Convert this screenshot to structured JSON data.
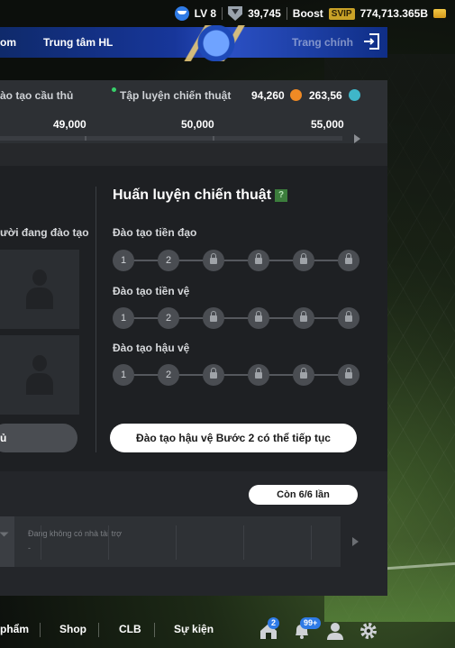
{
  "resources": {
    "level": "LV 8",
    "shield_value": "39,745",
    "boost_label": "Boost",
    "svip_label": "SVIP",
    "coins": "774,713.365B"
  },
  "nav": {
    "tab_left_partial": "om",
    "tab_center": "Trung tâm HL",
    "tab_right": "Trang chính"
  },
  "header": {
    "left_partial": "ào tạo cầu thủ",
    "right_label": "Tập luyện chiến thuật",
    "value_a": "94,260",
    "value_b": "263,56"
  },
  "progress": {
    "milestones": [
      "49,000",
      "50,000",
      "55,000"
    ]
  },
  "left_section": {
    "label_partial": "ười đang đào tạo",
    "button_partial": "ủ"
  },
  "tactical": {
    "title": "Huấn luyện chiến thuật",
    "help": "?",
    "tracks": [
      {
        "label": "Đào tạo tiền đạo",
        "steps": [
          "1",
          "2"
        ]
      },
      {
        "label": "Đào tạo tiền vệ",
        "steps": [
          "1",
          "2"
        ]
      },
      {
        "label": "Đào tạo hậu vệ",
        "steps": [
          "1",
          "2"
        ]
      }
    ],
    "cta": "Đào tạo hậu vệ Bước 2 có thể tiếp tục"
  },
  "footer": {
    "remaining": "Còn 6/6 lần",
    "sponsor_text": "Đang không có nhà tài trợ",
    "sponsor_dash": "-"
  },
  "bottom_nav": {
    "items": [
      "phẩm",
      "Shop",
      "CLB",
      "Sự kiện"
    ],
    "badge_home": "2",
    "badge_bell": "99+"
  },
  "colors": {
    "nav_blue": "#17369a",
    "accent_orange": "#f08a24",
    "accent_teal": "#3fb6c9",
    "online_green": "#38d16a"
  }
}
